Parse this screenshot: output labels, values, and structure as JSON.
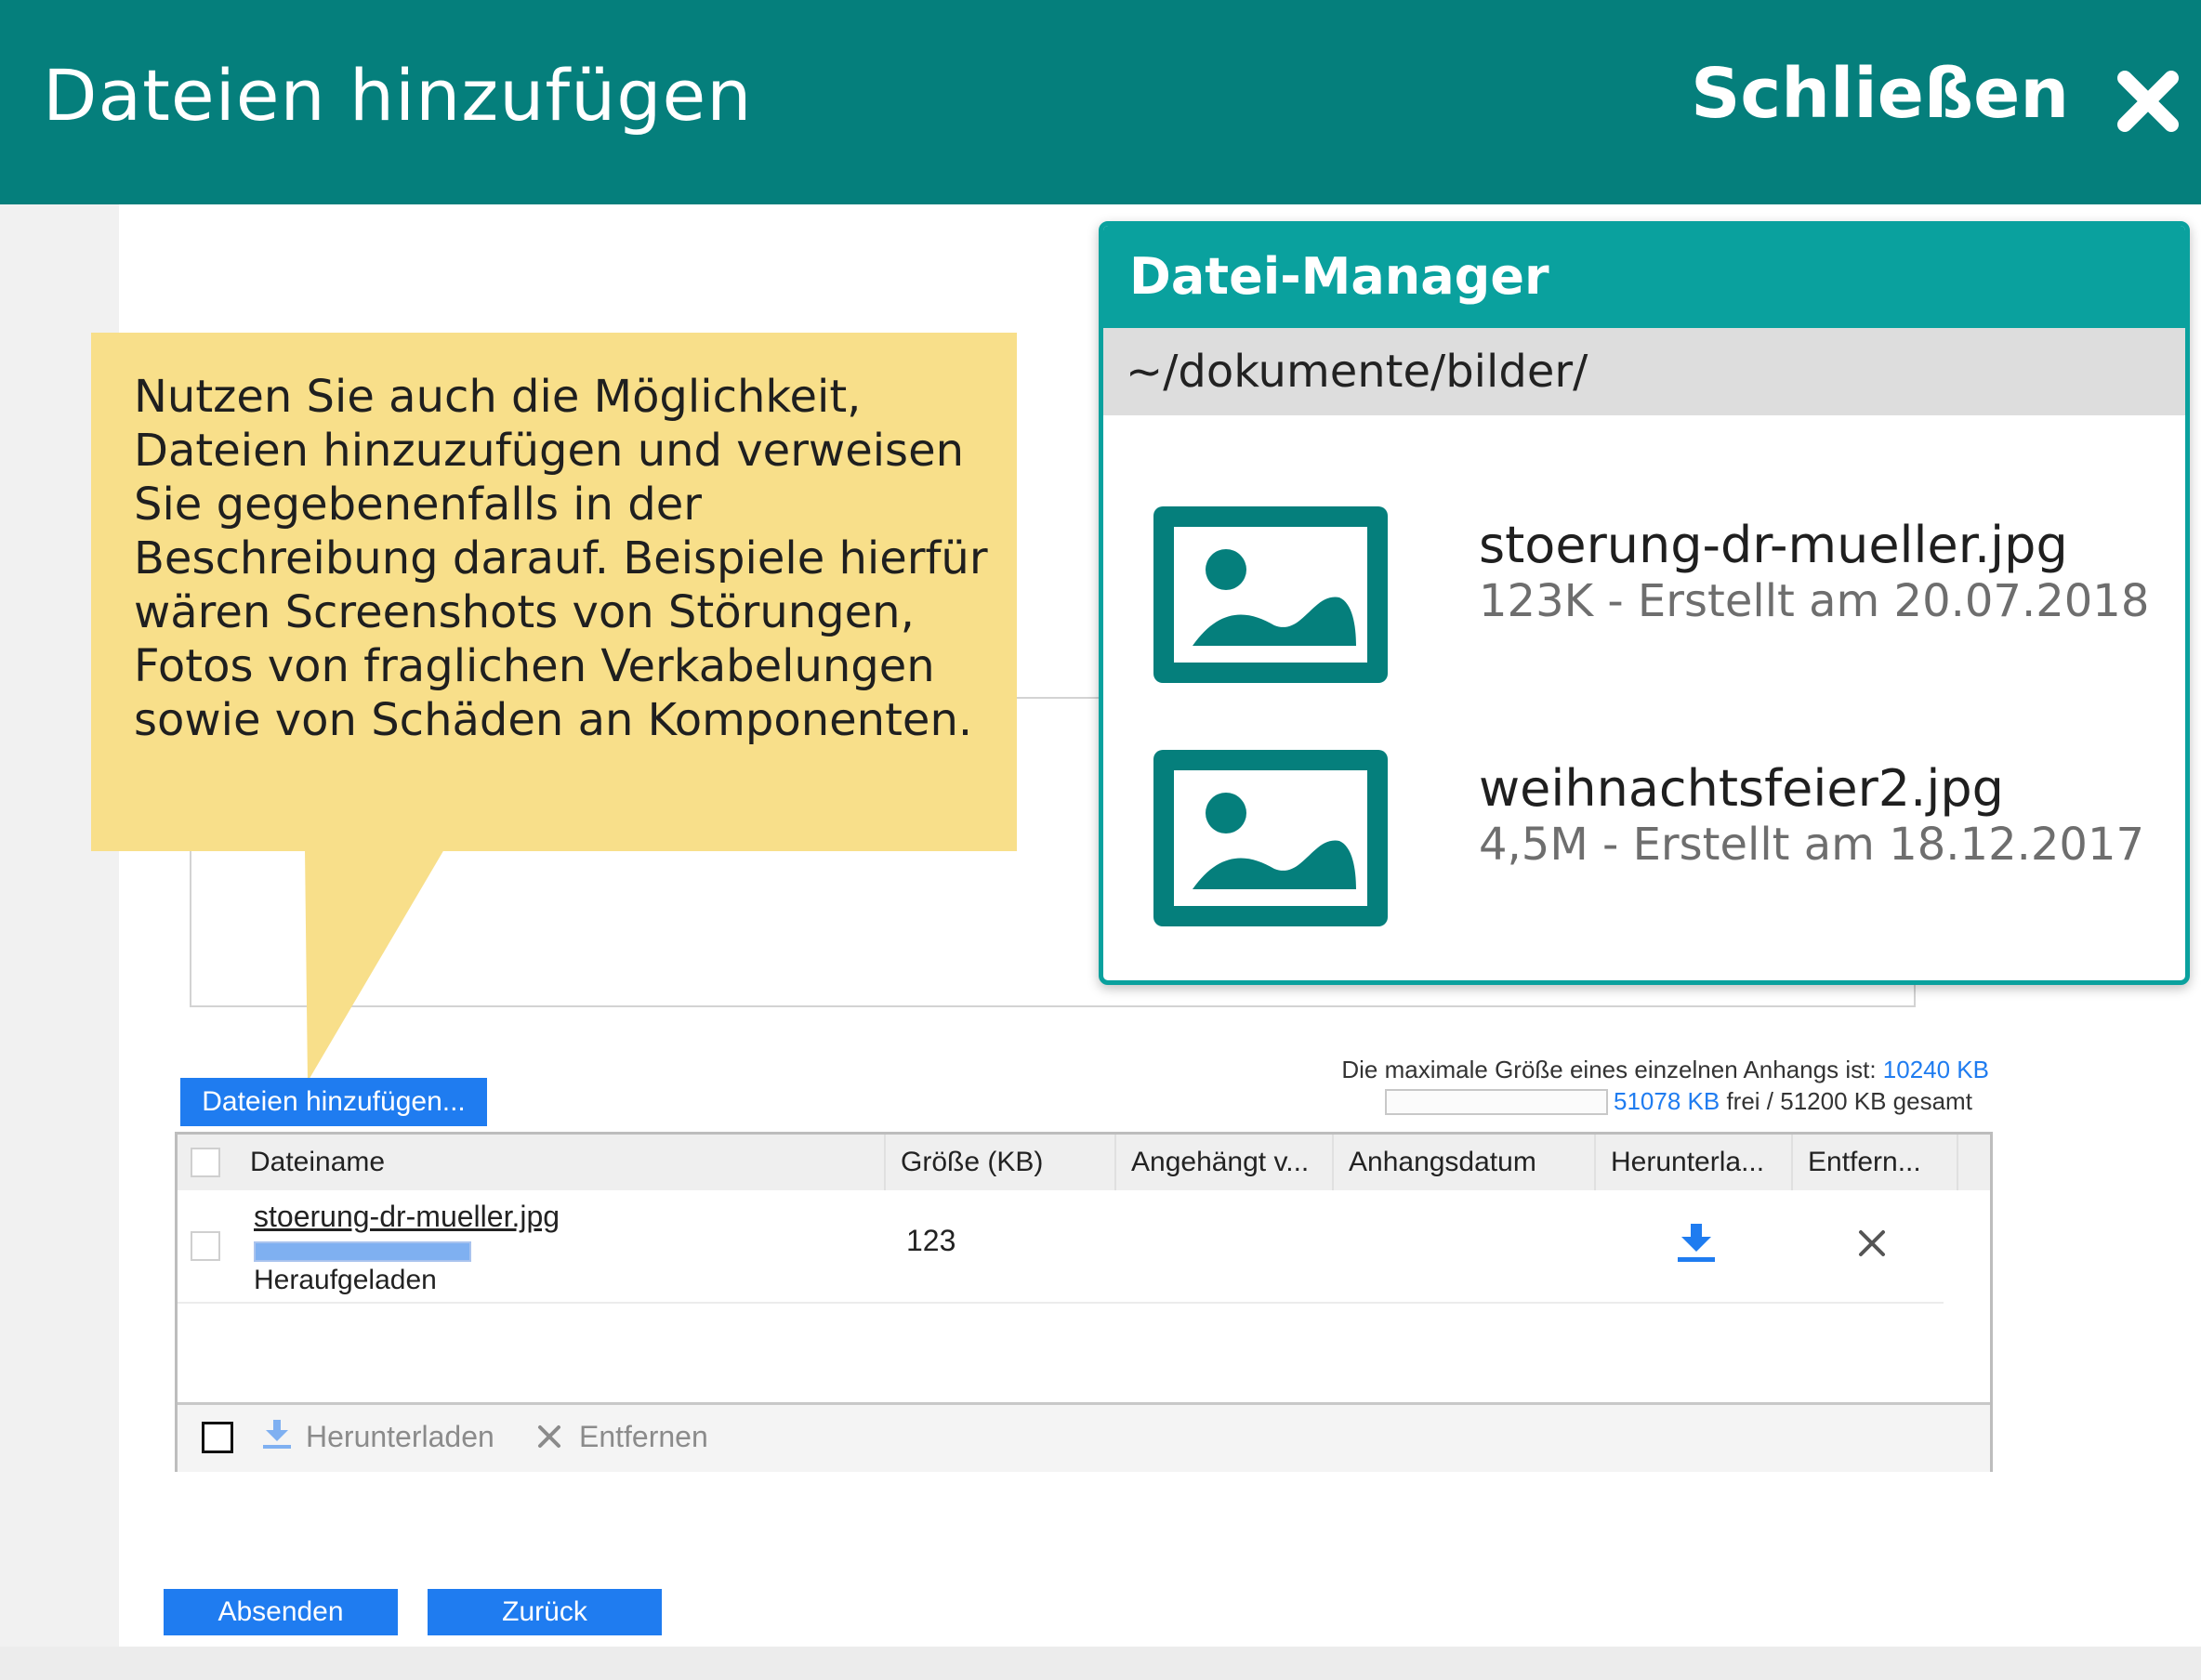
{
  "header": {
    "title": "Dateien hinzufügen",
    "close_label": "Schließen"
  },
  "callout": {
    "text": "Nutzen Sie auch die Möglichkeit, Dateien hinzuzufügen und verweisen Sie gegebenenfalls in der Beschreibung darauf. Beispiele hierfür wären Screenshots von Störungen, Fotos von fraglichen Verkabelungen sowie von Schäden an Komponenten."
  },
  "file_manager": {
    "title": "Datei-Manager",
    "path": "~/dokumente/bilder/",
    "files": [
      {
        "name": "stoerung-dr-mueller.jpg",
        "meta": "123K - Erstellt am 20.07.2018",
        "icon": "image-icon"
      },
      {
        "name": "weihnachtsfeier2.jpg",
        "meta": "4,5M - Erstellt am 18.12.2017",
        "icon": "image-icon"
      }
    ]
  },
  "upload": {
    "add_button": "Dateien hinzufügen...",
    "max_size_prefix": "Die maximale Größe eines einzelnen Anhangs ist:",
    "max_size_value": "10240 KB",
    "free_value": "51078 KB",
    "free_suffix": "frei / 51200 KB gesamt",
    "quota_used_fraction": 0.0024
  },
  "table": {
    "columns": [
      "Dateiname",
      "Größe (KB)",
      "Angehängt v...",
      "Anhangsdatum",
      "Herunterla...",
      "Entfern..."
    ],
    "rows": [
      {
        "filename": "stoerung-dr-mueller.jpg",
        "status": "Heraufgeladen",
        "size": "123",
        "attached_by": "",
        "date": "",
        "download_icon": "download-icon",
        "remove_icon": "remove-icon"
      }
    ],
    "footer": {
      "download": "Herunterladen",
      "remove": "Entfernen"
    }
  },
  "actions": {
    "submit": "Absenden",
    "back": "Zurück"
  },
  "colors": {
    "header_bg": "#057f7c",
    "file_manager_accent": "#0aa19e",
    "callout_bg": "#f8df8a",
    "button_blue": "#1f7cf0"
  }
}
